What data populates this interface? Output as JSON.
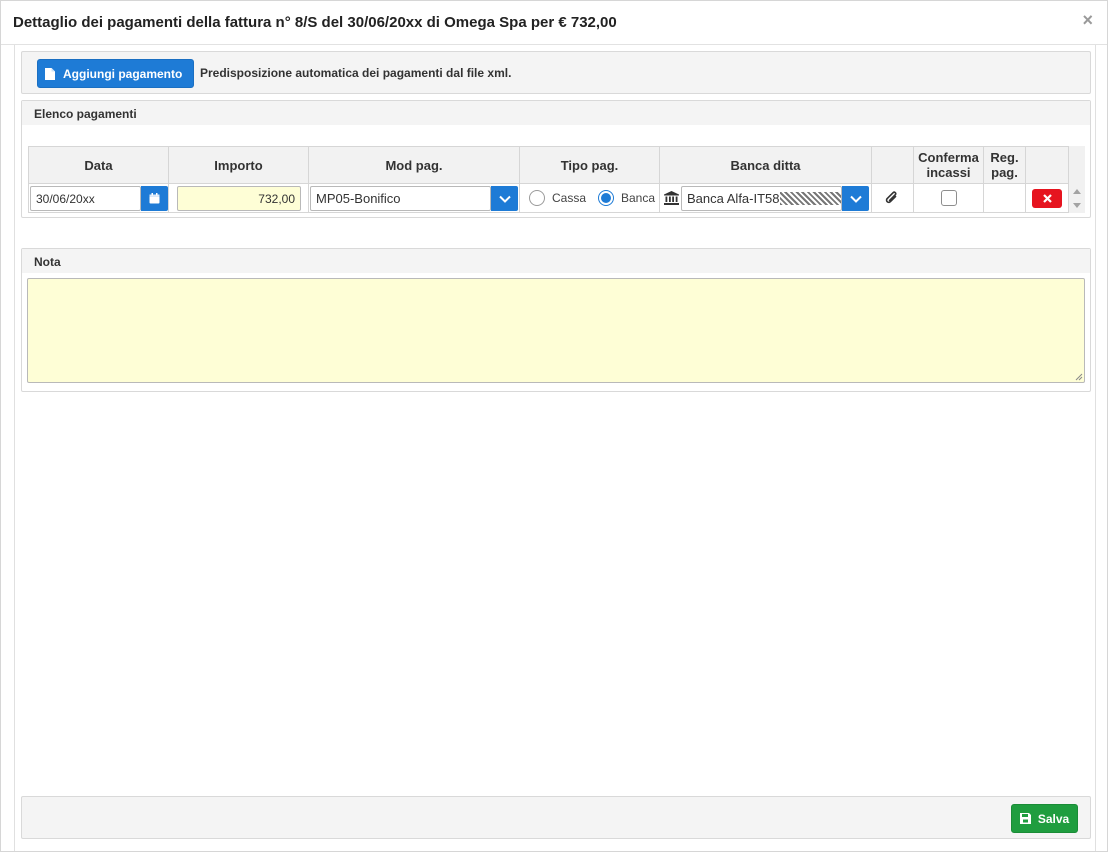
{
  "modal": {
    "title": "Dettaglio dei pagamenti della fattura n° 8/S del 30/06/20xx di Omega Spa per € 732,00",
    "close_glyph": "×"
  },
  "toolbar": {
    "add_payment_label": "Aggiungi pagamento",
    "info_text": "Predisposizione automatica dei pagamenti dal file xml."
  },
  "payments_panel": {
    "heading": "Elenco pagamenti",
    "columns": {
      "data": "Data",
      "importo": "Importo",
      "mod_pag": "Mod pag.",
      "tipo_pag": "Tipo pag.",
      "banca_ditta": "Banca ditta",
      "conferma_incassi_1": "Conferma",
      "conferma_incassi_2": "incassi",
      "reg_pag_1": "Reg.",
      "reg_pag_2": "pag."
    },
    "rows": [
      {
        "data": "30/06/20xx",
        "importo": "732,00",
        "mod_pag": "MP05-Bonifico",
        "tipo_pag_options": [
          "Cassa",
          "Banca"
        ],
        "tipo_pag_selected": "Banca",
        "banca_ditta": "Banca Alfa-IT58",
        "conferma_incassi_checked": false
      }
    ]
  },
  "note_panel": {
    "heading": "Nota",
    "value": ""
  },
  "footer": {
    "save_label": "Salva"
  },
  "colors": {
    "primary": "#1e7bd6",
    "success": "#1f9d3f",
    "danger": "#e6141f",
    "input_highlight": "#fefed6",
    "panel_bg": "#f4f4f4"
  },
  "icons": {
    "add_payment": "document-icon",
    "date_picker": "calendar-icon",
    "select_dropdown": "chevron-down-icon",
    "bank": "bank-icon",
    "attachment": "paperclip-icon",
    "delete": "times-icon",
    "save": "floppy-disk-icon",
    "close": "close-icon"
  }
}
